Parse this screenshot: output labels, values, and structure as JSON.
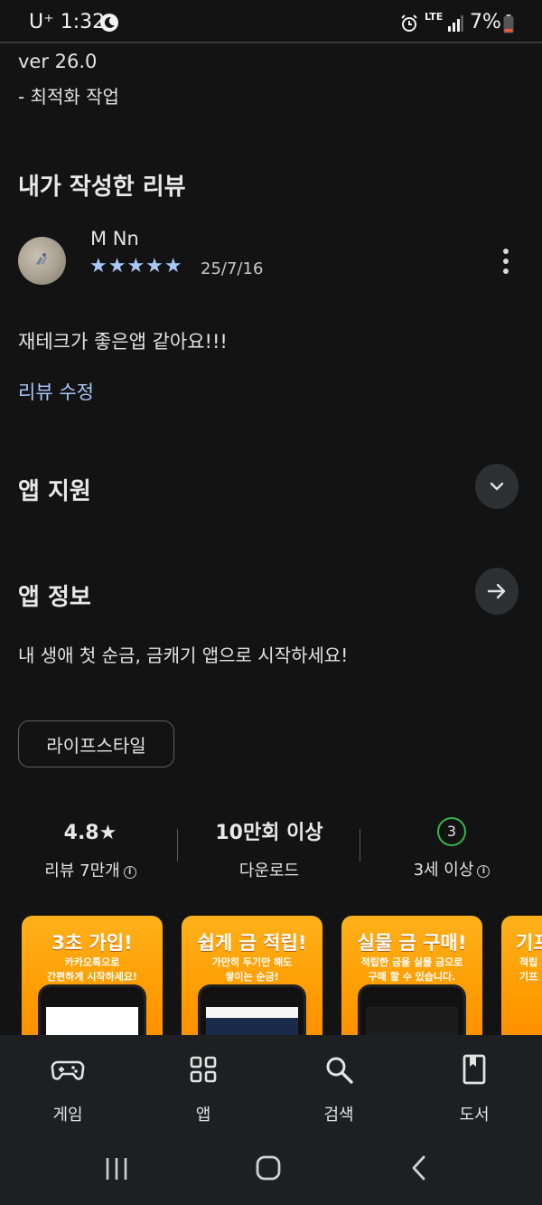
{
  "status_bar": {
    "carrier": "U⁺ 1:32",
    "network": "LTE",
    "battery": "7%"
  },
  "whats_new": {
    "version": "ver 26.0",
    "note": "- 최적화 작업"
  },
  "my_review": {
    "title": "내가 작성한 리뷰",
    "author": "M Nn",
    "stars": "★★★★★",
    "rating": 5,
    "date": "25/7/16",
    "text": "재테크가 좋은앱 같아요!!!",
    "edit_link": "리뷰 수정"
  },
  "app_support": {
    "title": "앱 지원"
  },
  "app_info": {
    "title": "앱 정보",
    "description": "내 생애 첫 순금, 금캐기 앱으로 시작하세요!",
    "category_chip": "라이프스타일"
  },
  "stats": {
    "rating": "4.8★",
    "reviews": "리뷰 7만개",
    "downloads": "10만회 이상",
    "downloads_label": "다운로드",
    "age_badge": "3",
    "age_label": "3세 이상",
    "info_glyph": "i"
  },
  "screenshots": [
    {
      "title": "3초 가입!",
      "subtitle": "카카오톡으로\n간편하게 시작하세요!"
    },
    {
      "title": "쉽게 금 적립!",
      "subtitle": "가만히 두기만 해도\n쌓이는 순금!"
    },
    {
      "title": "실물 금 구매!",
      "subtitle": "적립한 금을 실물 금으로\n구매 할 수 있습니다."
    },
    {
      "title": "기프",
      "subtitle": "적립\n기프"
    }
  ],
  "bottom_nav": {
    "games": "게임",
    "apps": "앱",
    "search": "검색",
    "books": "도서"
  },
  "colors": {
    "background": "#131314",
    "link": "#a8c7fa",
    "star": "#a8c7fa",
    "age_badge": "#37b24d",
    "screenshot_bg": "#ff9a00"
  }
}
